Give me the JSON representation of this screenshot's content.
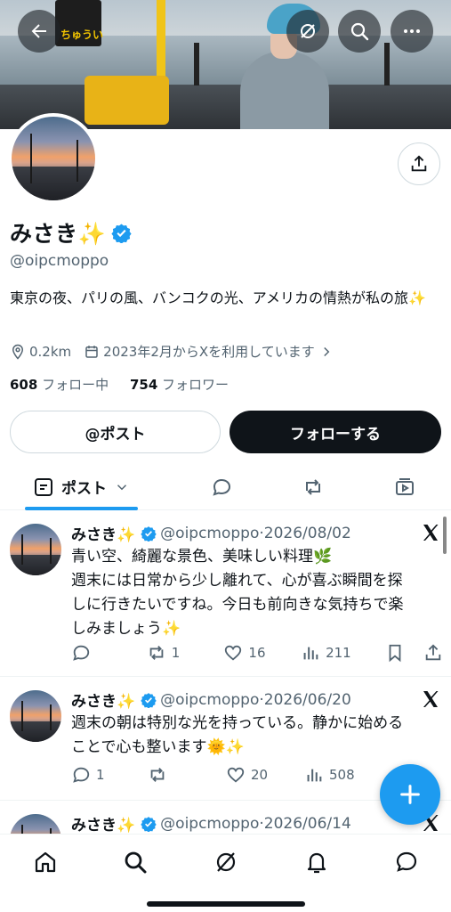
{
  "banner": {
    "sign_text": "ちゅうい"
  },
  "profile": {
    "name": "みさき✨",
    "handle": "@oipcmoppo",
    "bio": "東京の夜、パリの風、バンコクの光、アメリカの情熱が私の旅✨",
    "location": "0.2km",
    "joined": "2023年2月からXを利用しています",
    "following_count": "608",
    "following_label": "フォロー中",
    "followers_count": "754",
    "followers_label": "フォロワー"
  },
  "buttons": {
    "post_label": "@ポスト",
    "follow_label": "フォローする"
  },
  "tabs": {
    "active_label": "ポスト"
  },
  "posts": [
    {
      "name": "みさき✨",
      "handle": "@oipcmoppo",
      "date": "2026/08/02",
      "text_lines": [
        "青い空、綺麗な景色、美味しい料理🌿",
        "週末には日常から少し離れて、心が喜ぶ瞬間を探",
        "しに行きたいですね。今日も前向きな気持ちで楽",
        "しみましょう✨"
      ],
      "replies": "",
      "reposts": "1",
      "likes": "16",
      "views": "211"
    },
    {
      "name": "みさき✨",
      "handle": "@oipcmoppo",
      "date": "2026/06/20",
      "text_lines": [
        "週末の朝は特別な光を持っている。静かに始める",
        "ことで心も整います🌞✨"
      ],
      "replies": "1",
      "reposts": "",
      "likes": "20",
      "views": "508"
    },
    {
      "name": "みさき✨",
      "handle": "@oipcmoppo",
      "date": "2026/06/14"
    }
  ],
  "colors": {
    "accent": "#1d9bf0",
    "text": "#0f1419",
    "muted": "#536471"
  }
}
